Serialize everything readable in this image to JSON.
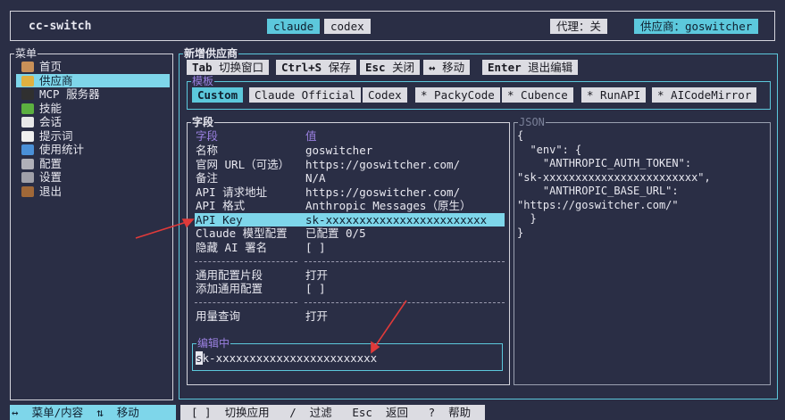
{
  "app": {
    "title": "cc-switch"
  },
  "tabs": [
    {
      "label": "claude",
      "active": true
    },
    {
      "label": "codex",
      "active": false
    }
  ],
  "topbar": {
    "proxy": "代理：关",
    "provider": "供应商：goswitcher"
  },
  "menu": {
    "title": "菜单",
    "items": [
      {
        "label": "首页",
        "icon": "house-icon",
        "color": "#c89058"
      },
      {
        "label": "供应商",
        "icon": "key-icon",
        "color": "#e0b040",
        "selected": true
      },
      {
        "label": "MCP 服务器",
        "icon": "plug-icon",
        "color": "#303030"
      },
      {
        "label": "技能",
        "icon": "puzzle-icon",
        "color": "#5cb040"
      },
      {
        "label": "会话",
        "icon": "clock-icon",
        "color": "#e8e8e8"
      },
      {
        "label": "提示词",
        "icon": "speech-bubble-icon",
        "color": "#f0f0f0"
      },
      {
        "label": "使用统计",
        "icon": "bar-chart-icon",
        "color": "#4a90d8"
      },
      {
        "label": "配置",
        "icon": "clipboard-icon",
        "color": "#b0b0b8"
      },
      {
        "label": "设置",
        "icon": "wrench-icon",
        "color": "#a0a0a8"
      },
      {
        "label": "退出",
        "icon": "door-icon",
        "color": "#a06838"
      }
    ]
  },
  "panel": {
    "title": "新增供应商",
    "keys": [
      {
        "key": "Tab",
        "desc": "切换窗口"
      },
      {
        "key": "Ctrl+S",
        "desc": "保存"
      },
      {
        "key": "Esc",
        "desc": "关闭"
      },
      {
        "key": "↔",
        "desc": "移动"
      },
      {
        "key": "Enter",
        "desc": "退出编辑"
      }
    ],
    "template_title": "模板",
    "templates": [
      {
        "label": "Custom",
        "selected": true
      },
      {
        "label": "Claude Official"
      },
      {
        "label": "Codex"
      },
      {
        "label": "* PackyCode"
      },
      {
        "label": "* Cubence"
      },
      {
        "label": "* RunAPI"
      },
      {
        "label": "* AICodeMirror"
      }
    ],
    "fields_title": "字段",
    "fields_header": {
      "key": "字段",
      "value": "值"
    },
    "fields": [
      {
        "key": "名称",
        "value": "goswitcher"
      },
      {
        "key": "官网 URL（可选）",
        "value": "https://goswitcher.com/"
      },
      {
        "key": "备注",
        "value": "N/A"
      },
      {
        "key": "API 请求地址",
        "value": "https://goswitcher.com/"
      },
      {
        "key": "API 格式",
        "value": "Anthropic Messages（原生）"
      },
      {
        "key": "API Key",
        "value": "sk-xxxxxxxxxxxxxxxxxxxxxxxx",
        "selected": true
      },
      {
        "key": "Claude 模型配置",
        "value": "已配置 0/5"
      },
      {
        "key": "隐藏 AI 署名",
        "value": "[ ]"
      },
      {
        "key": "通用配置片段",
        "value": "打开"
      },
      {
        "key": "添加通用配置",
        "value": "[ ]"
      },
      {
        "key": "用量查询",
        "value": "打开"
      }
    ],
    "editing_title": "编辑中",
    "editing_value": "sk-xxxxxxxxxxxxxxxxxxxxxxxx",
    "json_title": "JSON",
    "json_lines": [
      "{",
      "  \"env\": {",
      "    \"ANTHROPIC_AUTH_TOKEN\":",
      "\"sk-xxxxxxxxxxxxxxxxxxxxxxxx\",",
      "    \"ANTHROPIC_BASE_URL\":",
      "\"https://goswitcher.com/\"",
      "  }",
      "}"
    ]
  },
  "status": {
    "left": "↔  菜单/内容  ⇅  移动",
    "right": "[ ]  切换应用   /  过滤   Esc  返回   ?  帮助"
  },
  "colors": {
    "background": "#2a2e45",
    "accent": "#5cc8dc",
    "selection": "#7ed6ea",
    "header_purple": "#9a80e0",
    "arrow_red": "#e03a3a"
  }
}
